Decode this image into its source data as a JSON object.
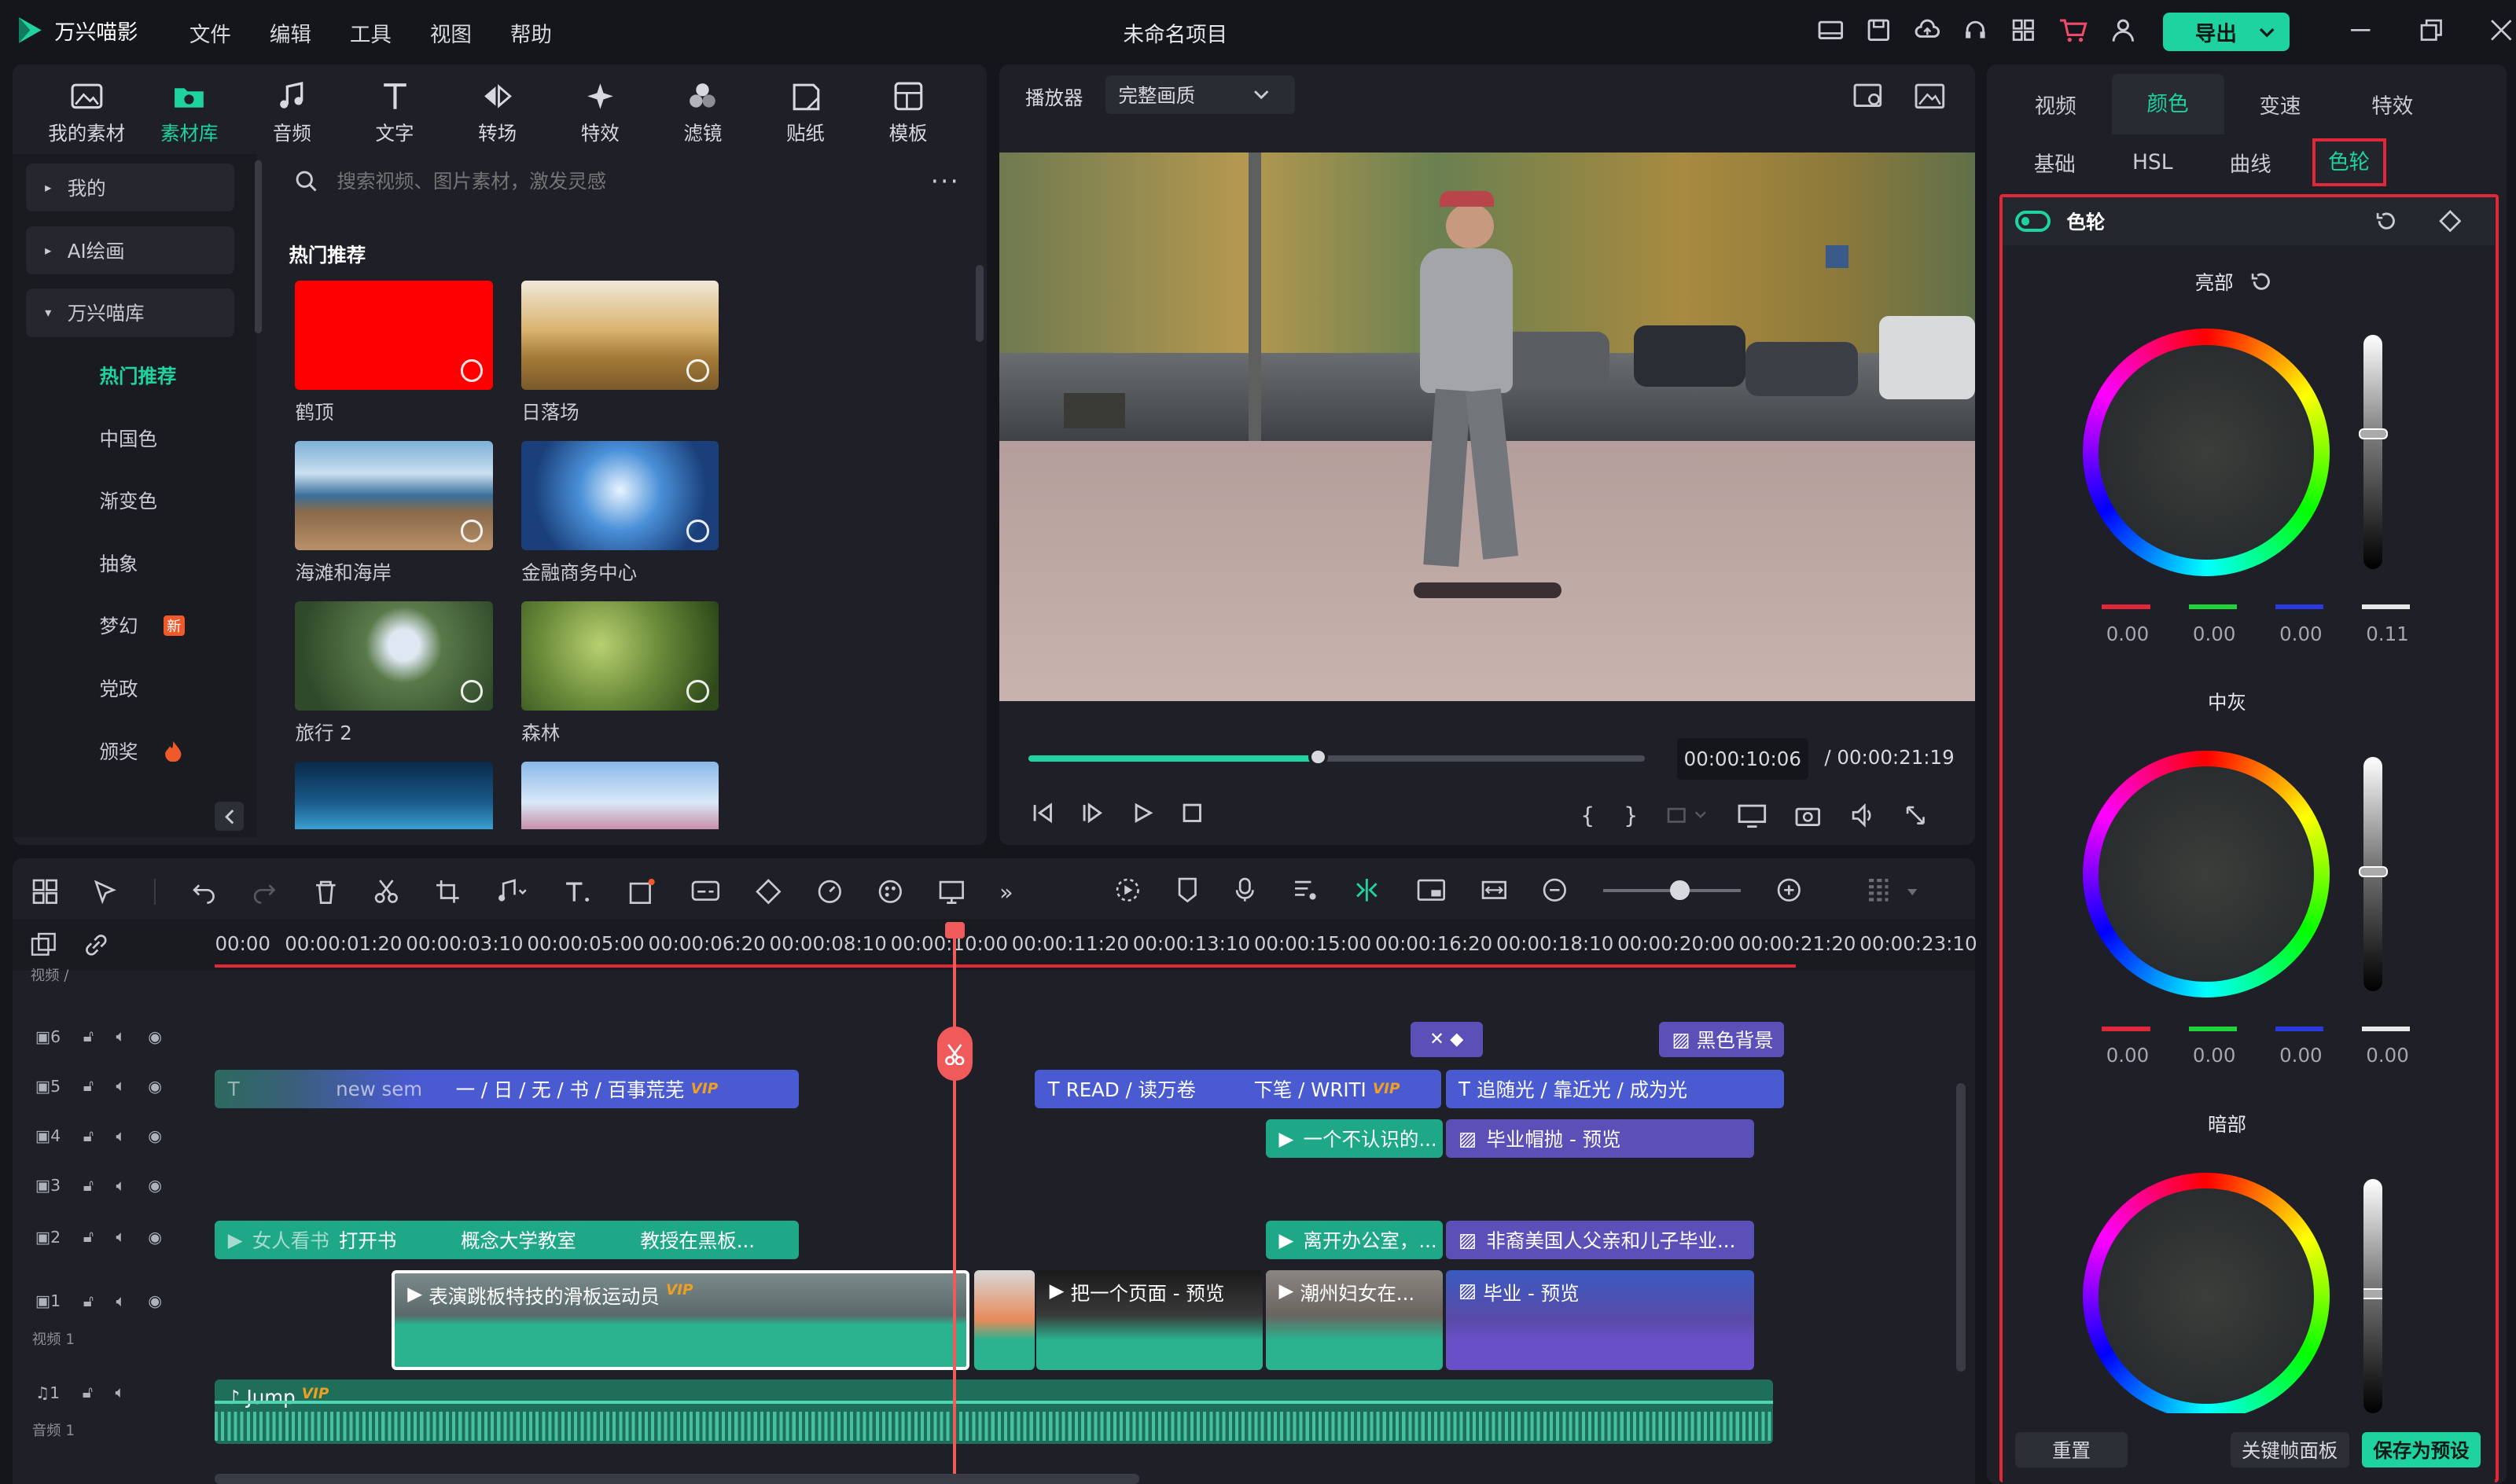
{
  "app": {
    "name": "万兴喵影",
    "project_title": "未命名项目",
    "export_label": "导出"
  },
  "menu": [
    "文件",
    "编辑",
    "工具",
    "视图",
    "帮助"
  ],
  "toolbar": [
    "我的素材",
    "素材库",
    "音频",
    "文字",
    "转场",
    "特效",
    "滤镜",
    "贴纸",
    "模板"
  ],
  "sidebar": {
    "groups": [
      "我的",
      "AI绘画",
      "万兴喵库"
    ],
    "items": [
      "热门推荐",
      "中国色",
      "渐变色",
      "抽象",
      "梦幻",
      "党政",
      "颁奖"
    ],
    "new_badge": "新"
  },
  "search": {
    "placeholder": "搜索视频、图片素材，激发灵感"
  },
  "library": {
    "section_title": "热门推荐",
    "items": [
      "鹤顶",
      "日落场",
      "海滩和海岸",
      "金融商务中心",
      "旅行 2",
      "森林"
    ]
  },
  "player": {
    "label": "播放器",
    "quality": "完整画质",
    "current_time": "00:00:10:06",
    "total_time": "/ 00:00:21:19",
    "progress": 0.47
  },
  "right_panel": {
    "tabs": [
      "视频",
      "颜色",
      "变速",
      "特效"
    ],
    "subtabs": [
      "基础",
      "HSL",
      "曲线",
      "色轮"
    ],
    "section_title": "色轮",
    "wheels": [
      {
        "label": "亮部",
        "values": [
          "0.00",
          "0.00",
          "0.00",
          "0.11"
        ]
      },
      {
        "label": "中灰",
        "values": [
          "0.00",
          "0.00",
          "0.00",
          "0.00"
        ]
      },
      {
        "label": "暗部",
        "values": []
      }
    ],
    "buttons": {
      "reset": "重置",
      "keyframe": "关键帧面板",
      "save_preset": "保存为预设"
    }
  },
  "timeline": {
    "ruler": [
      "00:00",
      "00:00:01:20",
      "00:00:03:10",
      "00:00:05:00",
      "00:00:06:20",
      "00:00:08:10",
      "00:00:10:00",
      "00:00:11:20",
      "00:00:13:10",
      "00:00:15:00",
      "00:00:16:20",
      "00:00:18:10",
      "00:00:20:00",
      "00:00:21:20",
      "00:00:23:10"
    ],
    "track_labels": {
      "video_top": "视频 /",
      "video1": "视频 1",
      "audio1": "音频 1"
    },
    "track_numbers": [
      "6",
      "5",
      "4",
      "3",
      "2",
      "1",
      "1"
    ],
    "clips": {
      "bg_black": "黑色背景",
      "t5a_pre": "new sem",
      "t5a": "一 / 日 / 无 / 书 / 百事荒芜",
      "t5b": "READ / 读万卷",
      "t5b_post": "下笔 / WRITI",
      "t5c": "追随光 / 靠近光 / 成为光",
      "t4a": "一个不认识的...",
      "t4b": "毕业帽抛 - 预览",
      "t2a": "女人看书",
      "t2b": "打开书",
      "t2c": "概念大学教室",
      "t2d": "教授在黑板...",
      "t2e": "离开办公室，...",
      "t2f": "非裔美国人父亲和儿子毕业...",
      "v1a": "表演跳板特技的滑板运动员",
      "v1b": "把一个页面 - 预览",
      "v1c": "潮州妇女在...",
      "v1d": "毕业 - 预览",
      "audio": "Jump",
      "vip": "VIP"
    }
  },
  "colors": {
    "accent": "#1fd3a0",
    "highlight_border": "#e0283a",
    "playhead": "#f05a5a"
  }
}
